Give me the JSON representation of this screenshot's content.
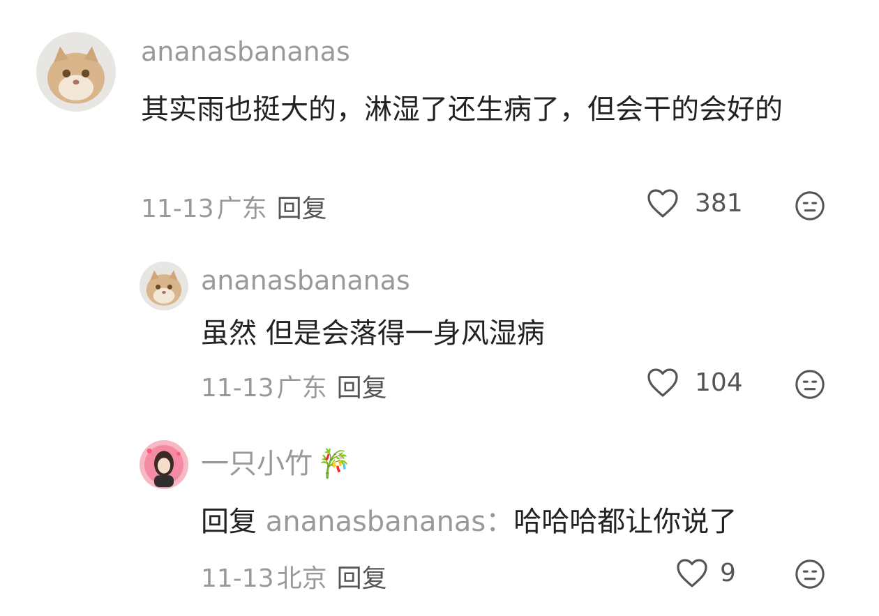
{
  "comments": [
    {
      "username": "ananasbananas",
      "text": "其实雨也挺大的，淋湿了还生病了，但会干的会好的",
      "date": "11-13",
      "location": "广东",
      "reply_label": "回复",
      "likes": "381",
      "avatar": "cat-avatar"
    },
    {
      "username": "ananasbananas",
      "text": "虽然 但是会落得一身风湿病",
      "date": "11-13",
      "location": "广东",
      "reply_label": "回复",
      "likes": "104",
      "avatar": "cat-avatar"
    },
    {
      "username": "一只小竹",
      "username_emoji": "🎋",
      "reply_prefix": "回复",
      "mention": "ananasbananas",
      "mention_sep": "：",
      "text": "哈哈哈都让你说了",
      "date": "11-13",
      "location": "北京",
      "reply_label": "回复",
      "likes": "9",
      "avatar": "girl-avatar"
    }
  ],
  "colors": {
    "meta_gray": "#999999",
    "text_dark": "#222222",
    "icon_gray": "#555555"
  }
}
